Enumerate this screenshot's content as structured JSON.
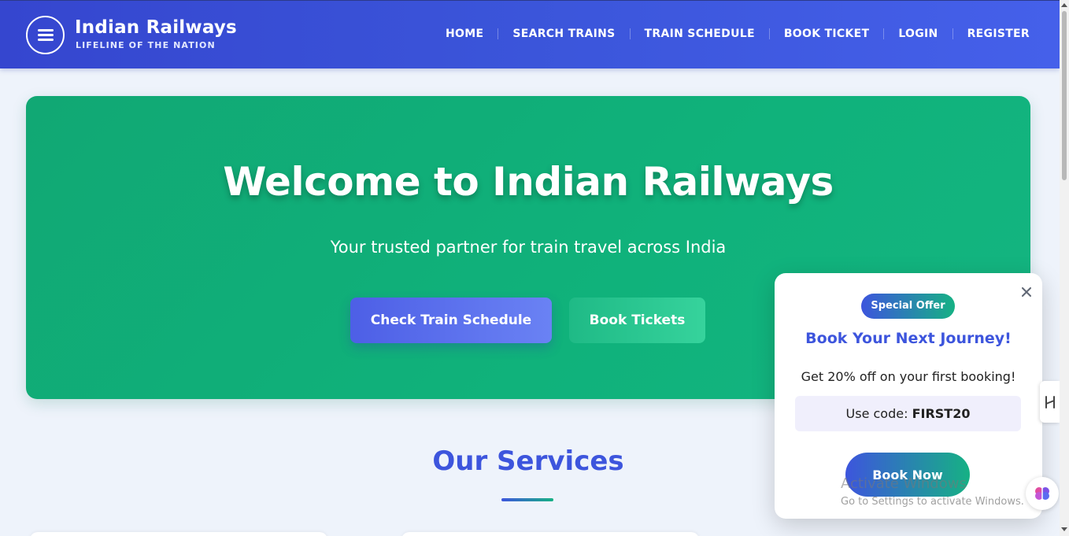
{
  "brand": {
    "title": "Indian Railways",
    "subtitle": "LIFELINE OF THE NATION",
    "logo_icon": "train-lines-icon"
  },
  "nav": {
    "items": [
      {
        "label": "HOME"
      },
      {
        "label": "SEARCH TRAINS"
      },
      {
        "label": "TRAIN SCHEDULE"
      },
      {
        "label": "BOOK TICKET"
      },
      {
        "label": "LOGIN"
      },
      {
        "label": "REGISTER"
      }
    ]
  },
  "hero": {
    "title": "Welcome to Indian Railways",
    "subtitle": "Your trusted partner for train travel across India",
    "primary_button": "Check Train Schedule",
    "secondary_button": "Book Tickets"
  },
  "services": {
    "title": "Our Services"
  },
  "popup": {
    "close_icon": "close-icon",
    "badge": "Special Offer",
    "title": "Book Your Next Journey!",
    "text": "Get 20% off on your first booking!",
    "code_label": "Use code:",
    "code_value": "FIRST20",
    "button": "Book Now"
  },
  "watermark": {
    "title": "Activate Windows",
    "subtitle": "Go to Settings to activate Windows."
  },
  "colors": {
    "nav_start": "#3546cf",
    "nav_end": "#4560ea",
    "hero_green": "#10b27b",
    "accent_blue": "#3d55dd",
    "accent_green": "#16b184"
  }
}
